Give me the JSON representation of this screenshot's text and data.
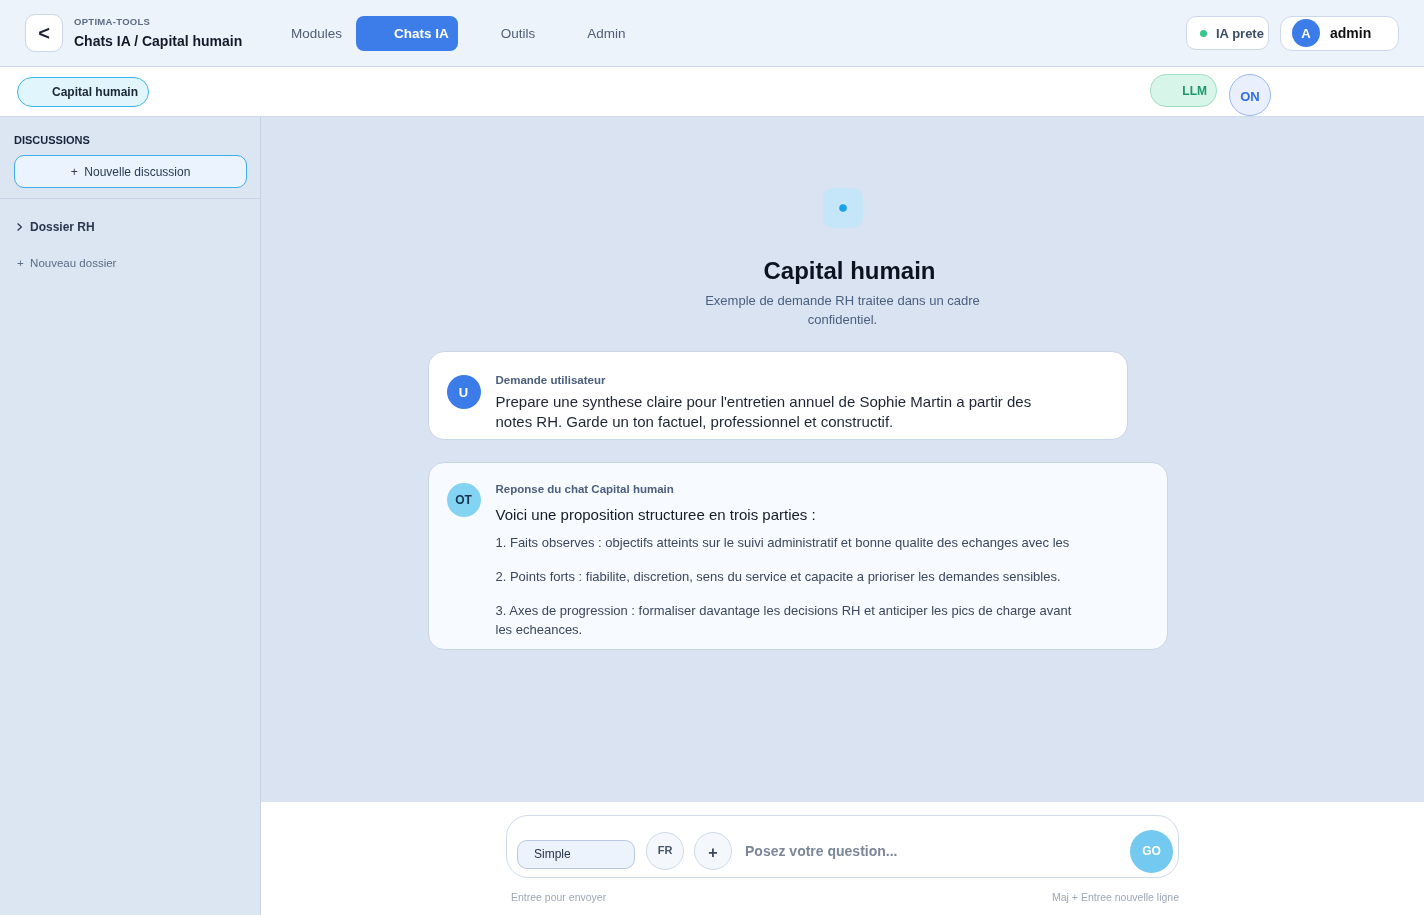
{
  "header": {
    "back": "<",
    "brand": "OPTIMA-TOOLS",
    "title": "Chats IA / Capital humain"
  },
  "nav": [
    {
      "label": "Modules",
      "selected": false
    },
    {
      "label": "Chats IA",
      "selected": true
    },
    {
      "label": "Outils",
      "selected": false
    },
    {
      "label": "Admin",
      "selected": false
    }
  ],
  "status": {
    "label": "IA prete"
  },
  "user": {
    "initial": "A",
    "name": "admin"
  },
  "toolbar": {
    "chip": "Capital humain",
    "badge": "LLM",
    "toggle": "ON"
  },
  "sidebar": {
    "heading": "DISCUSSIONS",
    "new_button": "+  Nouvelle discussion",
    "folders": [
      {
        "label": "Dossier RH",
        "expanded": false
      }
    ],
    "new_folder": "+  Nouveau dossier"
  },
  "hero": {
    "title": "Capital humain",
    "subtitle": "Exemple de demande RH traitee dans un cadre confidentiel."
  },
  "messages": [
    {
      "kind": "user",
      "avatar": "U",
      "label": "Demande utilisateur",
      "text": "Prepare une synthese claire pour l'entretien annuel de Sophie Martin a partir des notes RH. Garde un ton factuel, professionnel et constructif."
    },
    {
      "kind": "assistant",
      "avatar": "OT",
      "label": "Reponse du chat Capital humain",
      "intro": "Voici une proposition structuree en trois parties :",
      "items": [
        "1. Faits observes : objectifs atteints sur le suivi administratif et bonne qualite des echanges avec les",
        "2. Points forts : fiabilite, discretion, sens du service et capacite a prioriser les demandes sensibles.",
        "3. Axes de progression : formaliser davantage les decisions RH et anticiper les pics de charge avant les echeances."
      ]
    }
  ],
  "composer": {
    "mode": "Simple",
    "language": "FR",
    "attach": "+",
    "placeholder": "Posez votre question...",
    "send": "GO",
    "hint_left": "Entree pour envoyer",
    "hint_right": "Maj + Entree nouvelle ligne"
  }
}
